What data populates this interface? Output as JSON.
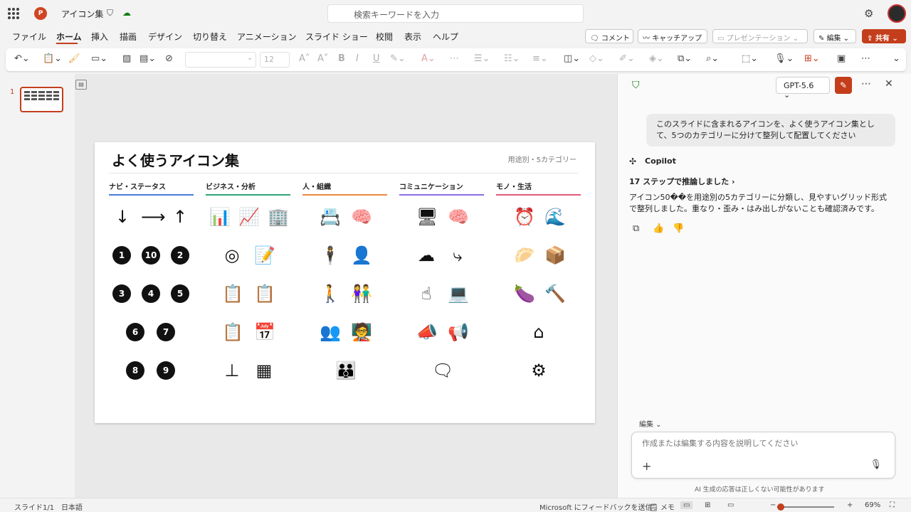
{
  "app": {
    "doc_name": "アイコン集",
    "search_placeholder": "検索キーワードを入力"
  },
  "menu": [
    "ファイル",
    "ホーム",
    "挿入",
    "描画",
    "デザイン",
    "切り替え",
    "アニメーション",
    "スライド ショー",
    "校閲",
    "表示",
    "ヘルプ"
  ],
  "ribbon_buttons": {
    "comment": "コメント",
    "catchup": "キャッチアップ",
    "present": "プレゼンテーション",
    "edit": "編集",
    "share": "共有"
  },
  "toolbar": {
    "font_size": "12"
  },
  "thumbnail": {
    "number": "1"
  },
  "slide": {
    "title": "よく使うアイコン集",
    "subtitle": "用途別・5カテゴリー",
    "categories": [
      {
        "label": "ナビ・ステータス",
        "color": "#4a7bd8"
      },
      {
        "label": "ビジネス・分析",
        "color": "#2aa876"
      },
      {
        "label": "人・組織",
        "color": "#f0883e"
      },
      {
        "label": "コミュニケーション",
        "color": "#8b6fe0"
      },
      {
        "label": "モノ・生活",
        "color": "#e05a7a"
      }
    ],
    "numbers": [
      "1",
      "10",
      "2",
      "3",
      "4",
      "5",
      "6",
      "7",
      "8",
      "9"
    ]
  },
  "copilot": {
    "model": "GPT-5.6",
    "user_message": "このスライドに含まれるアイコンを、よく使うアイコン集として、5つのカテゴリーに分けて整列して配置してください",
    "name": "Copilot",
    "steps": "17 ステップで推論しました",
    "answer": "アイコン50��を用途別の5カテゴリーに分類し、見やすいグリッド形式で整列しました。重なり・歪み・はみ出しがないことも確認済みです。",
    "edit_mode": "編集",
    "input_placeholder": "作成または編集する内容を説明してください",
    "disclaimer": "AI 生成の応答は正しくない可能性があります"
  },
  "status": {
    "slide_info": "スライド1/1",
    "language": "日本語",
    "feedback": "Microsoft にフィードバックを送信",
    "notes": "メモ",
    "zoom": "69%"
  }
}
